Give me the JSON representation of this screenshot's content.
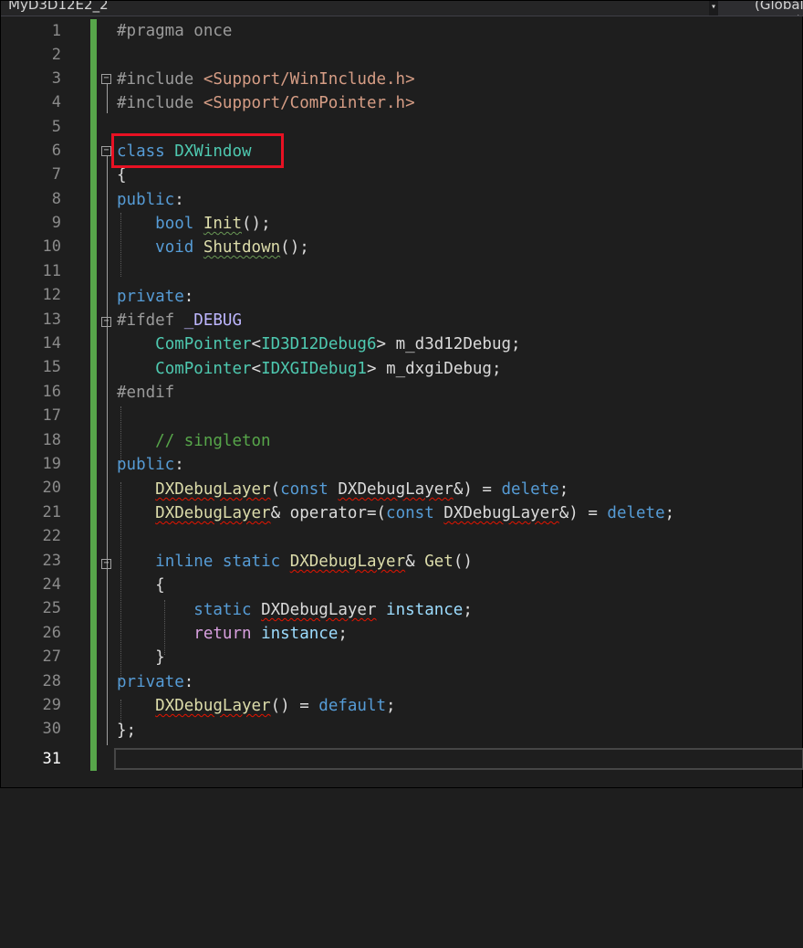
{
  "nav": {
    "project": "MyD3D12E2_2",
    "dropdown_glyph": "▾",
    "scope": "(Global Scope)"
  },
  "editor": {
    "current_line": "31",
    "lines": [
      {
        "n": "1"
      },
      {
        "n": "2"
      },
      {
        "n": "3"
      },
      {
        "n": "4"
      },
      {
        "n": "5"
      },
      {
        "n": "6"
      },
      {
        "n": "7"
      },
      {
        "n": "8"
      },
      {
        "n": "9"
      },
      {
        "n": "10"
      },
      {
        "n": "11"
      },
      {
        "n": "12"
      },
      {
        "n": "13"
      },
      {
        "n": "14"
      },
      {
        "n": "15"
      },
      {
        "n": "16"
      },
      {
        "n": "17"
      },
      {
        "n": "18"
      },
      {
        "n": "19"
      },
      {
        "n": "20"
      },
      {
        "n": "21"
      },
      {
        "n": "22"
      },
      {
        "n": "23"
      },
      {
        "n": "24"
      },
      {
        "n": "25"
      },
      {
        "n": "26"
      },
      {
        "n": "27"
      },
      {
        "n": "28"
      },
      {
        "n": "29"
      },
      {
        "n": "30"
      },
      {
        "n": "31"
      }
    ],
    "code": {
      "l1": [
        "#pragma",
        " once"
      ],
      "l3": [
        "#include",
        " ",
        "<Support/WinInclude.h>"
      ],
      "l4": [
        "#include",
        " ",
        "<Support/ComPointer.h>"
      ],
      "l6": [
        "class",
        " ",
        "DXWindow"
      ],
      "l7": [
        "{"
      ],
      "l8": [
        "public",
        ":"
      ],
      "l9": [
        "    ",
        "bool",
        " ",
        "Init",
        "();"
      ],
      "l10": [
        "    ",
        "void",
        " ",
        "Shutdown",
        "();"
      ],
      "l12": [
        "private",
        ":"
      ],
      "l13": [
        "#ifdef",
        " ",
        "_DEBUG"
      ],
      "l14": [
        "    ",
        "ComPointer",
        "<",
        "ID3D12Debug6",
        ">",
        " ",
        "m_d3d12Debug",
        ";"
      ],
      "l15": [
        "    ",
        "ComPointer",
        "<",
        "IDXGIDebug1",
        ">",
        " ",
        "m_dxgiDebug",
        ";"
      ],
      "l16": [
        "#endif"
      ],
      "l18": [
        "    ",
        "// singleton"
      ],
      "l19": [
        "public",
        ":"
      ],
      "l20": [
        "    ",
        "DXDebugLayer",
        "(",
        "const",
        " ",
        "DXDebugLayer",
        "&) = ",
        "delete",
        ";"
      ],
      "l21": [
        "    ",
        "DXDebugLayer",
        "& ",
        "operator=",
        "(",
        "const",
        " ",
        "DXDebugLayer",
        "&) = ",
        "delete",
        ";"
      ],
      "l23": [
        "    ",
        "inline",
        " ",
        "static",
        " ",
        "DXDebugLayer",
        "& ",
        "Get",
        "()"
      ],
      "l24": [
        "    ",
        "{"
      ],
      "l25": [
        "        ",
        "static",
        " ",
        "DXDebugLayer",
        " ",
        "instance",
        ";"
      ],
      "l26": [
        "        ",
        "return",
        " ",
        "instance",
        ";"
      ],
      "l27": [
        "    ",
        "}"
      ],
      "l28": [
        "private",
        ":"
      ],
      "l29": [
        "    ",
        "DXDebugLayer",
        "() = ",
        "default",
        ";"
      ],
      "l30": [
        "};"
      ]
    }
  },
  "colors": {
    "background": "#1e1e1e",
    "keyword": "#569cd6",
    "type": "#4ec9b0",
    "string": "#d69d85",
    "function": "#dcdcaa",
    "comment": "#57a64a",
    "control": "#d8a0df",
    "highlight_box": "#e81123",
    "change_bar": "#57a64a"
  }
}
